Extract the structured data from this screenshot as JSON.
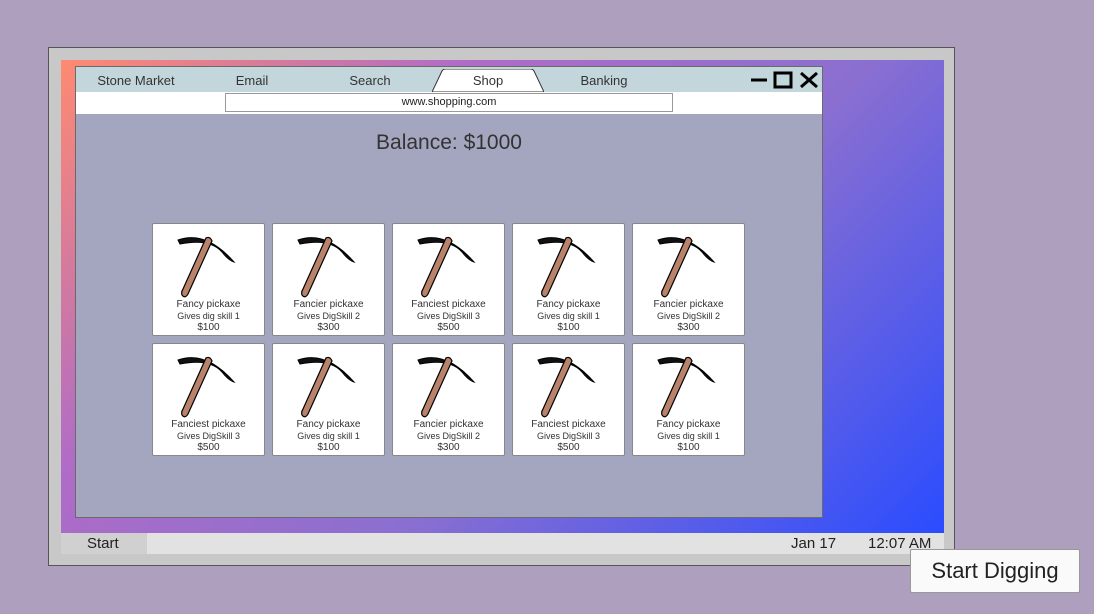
{
  "browser": {
    "tabs": [
      "Stone Market",
      "Email",
      "Search",
      "Shop",
      "Banking"
    ],
    "active_tab": "Shop",
    "url": "www.shopping.com"
  },
  "shop": {
    "balance": "Balance: $1000",
    "items": [
      {
        "name": "Fancy pickaxe",
        "desc": "Gives dig skill 1",
        "price": "$100"
      },
      {
        "name": "Fancier pickaxe",
        "desc": "Gives DigSkill 2",
        "price": "$300"
      },
      {
        "name": "Fanciest pickaxe",
        "desc": "Gives DigSkill 3",
        "price": "$500"
      },
      {
        "name": "Fancy pickaxe",
        "desc": "Gives dig skill 1",
        "price": "$100"
      },
      {
        "name": "Fancier pickaxe",
        "desc": "Gives DigSkill 2",
        "price": "$300"
      },
      {
        "name": "Fanciest pickaxe",
        "desc": "Gives DigSkill 3",
        "price": "$500"
      },
      {
        "name": "Fancy pickaxe",
        "desc": "Gives dig skill 1",
        "price": "$100"
      },
      {
        "name": "Fancier pickaxe",
        "desc": "Gives DigSkill 2",
        "price": "$300"
      },
      {
        "name": "Fanciest pickaxe",
        "desc": "Gives DigSkill 3",
        "price": "$500"
      },
      {
        "name": "Fancy pickaxe",
        "desc": "Gives dig skill 1",
        "price": "$100"
      }
    ]
  },
  "taskbar": {
    "start": "Start",
    "date": "Jan 17",
    "time": "12:07 AM"
  },
  "actions": {
    "start_digging": "Start Digging"
  },
  "icons": {
    "item": "pickaxe-icon",
    "minimize": "minimize-icon",
    "maximize": "maximize-icon",
    "close": "close-icon"
  },
  "colors": {
    "tab_bar": "#c3d6dc",
    "window_bg": "#a4a6bf",
    "handle": "#b9826a"
  }
}
